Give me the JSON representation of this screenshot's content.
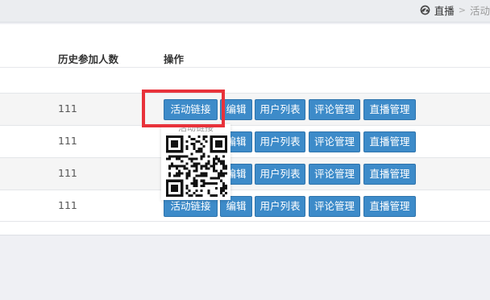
{
  "breadcrumb": {
    "current": "直播",
    "next_partial": "活动"
  },
  "table": {
    "headers": {
      "history_participants": "历史参加人数",
      "actions": "操作"
    },
    "rows": [
      {
        "history_participants": "111"
      },
      {
        "history_participants": "111"
      },
      {
        "history_participants": "111"
      },
      {
        "history_participants": "111"
      }
    ],
    "actions": {
      "activity_link": "活动链接",
      "edit": "编辑",
      "user_list": "用户列表",
      "comment_management": "评论管理",
      "live_management": "直播管理"
    }
  },
  "qr_popup": {
    "caption": "活动链接"
  },
  "colors": {
    "button_bg": "#3d8bc9",
    "highlight": "#e8323a",
    "stripe": "#f5f5f5"
  },
  "icons": {
    "breadcrumb": "dashboard-icon",
    "popup": "qr-code-icon"
  }
}
